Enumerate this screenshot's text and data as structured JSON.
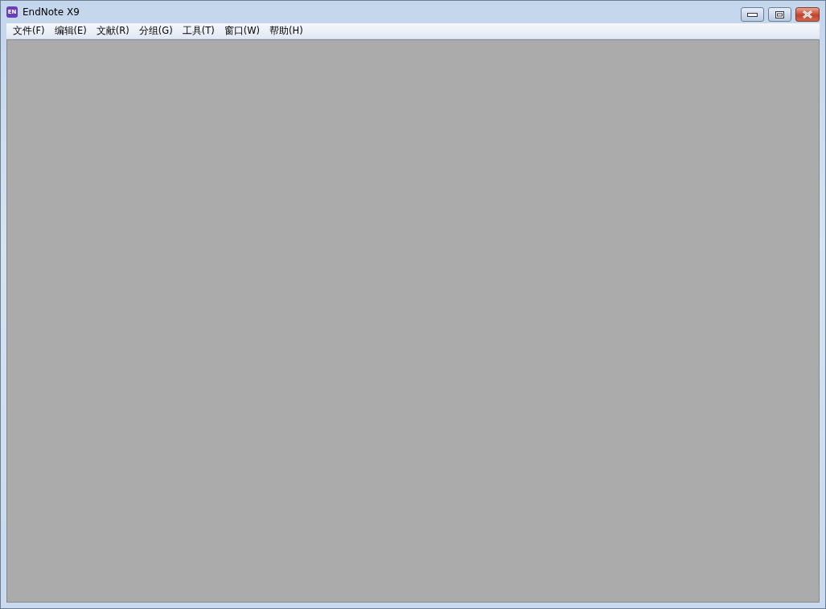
{
  "window": {
    "title": "EndNote X9",
    "logo_text": "EN"
  },
  "menu": [
    "文件(F)",
    "编辑(E)",
    "文献(R)",
    "分组(G)",
    "工具(T)",
    "窗口(W)",
    "帮助(H)"
  ]
}
